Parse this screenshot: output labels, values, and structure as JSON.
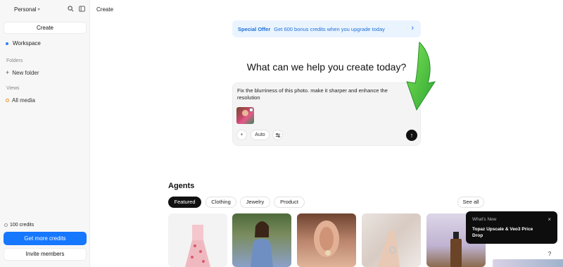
{
  "sidebar": {
    "workspace": "Personal",
    "create_label": "Create",
    "workspace_item": "Workspace",
    "folders_label": "Folders",
    "new_folder": "New folder",
    "views_label": "Views",
    "all_media": "All media",
    "credits": "100 credits",
    "get_more": "Get more credits",
    "invite": "Invite members"
  },
  "header": {
    "title": "Create"
  },
  "offer": {
    "title": "Special Offer",
    "text": "Get 600 bonus credits when you upgrade today"
  },
  "main": {
    "headline": "What can we help you create today?",
    "prompt": "Fix the blurriness of this photo. make it sharper and enhance the resolution",
    "auto_label": "Auto"
  },
  "agents": {
    "title": "Agents",
    "tabs": [
      "Featured",
      "Clothing",
      "Jewelry",
      "Product"
    ],
    "see_all": "See all"
  },
  "toast": {
    "label": "What's New",
    "message": "Topaz Upscale & Veo3 Price Drop"
  },
  "help_label": "?",
  "colors": {
    "accent": "#1677ff",
    "offer_bg": "#eaf4ff",
    "arrow_green": "#3fbf3a"
  }
}
